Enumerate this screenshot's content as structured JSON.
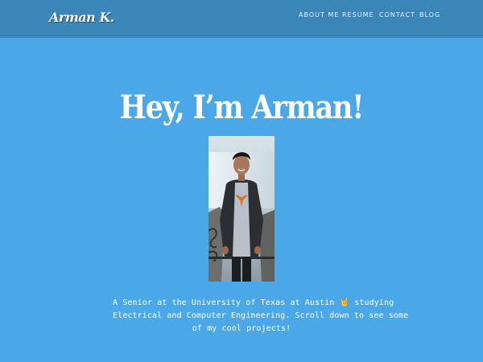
{
  "brand": {
    "name": "Arman K."
  },
  "nav": {
    "items": [
      {
        "label": "ABOUT ME"
      },
      {
        "label": "RESUME"
      },
      {
        "label": "CONTACT"
      },
      {
        "label": "BLOG"
      }
    ]
  },
  "hero": {
    "title": "Hey, I’m Arman!",
    "photo_icon": "person-photo",
    "bio": {
      "line1_before_emoji": "A Senior at the University of Texas at Austin",
      "emoji": "🤘",
      "line1_after_emoji": "studying",
      "line2": "Electrical and Computer Engineering. Scroll down to see some",
      "line3": "of my cool projects!"
    }
  },
  "colors": {
    "background": "#4aa8e8",
    "navbar": "#3a86b8",
    "text": "#ffffff"
  }
}
